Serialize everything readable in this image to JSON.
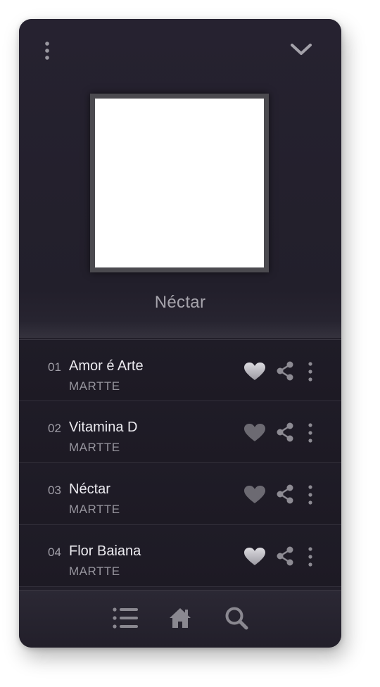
{
  "album": {
    "title": "Néctar"
  },
  "header": {
    "menu_icon": "vertical-dots-icon",
    "collapse_icon": "chevron-down-icon"
  },
  "tracks": [
    {
      "number": "01",
      "title": "Amor é Arte",
      "artist": "MARTTE",
      "liked": true
    },
    {
      "number": "02",
      "title": "Vitamina D",
      "artist": "MARTTE",
      "liked": false
    },
    {
      "number": "03",
      "title": "Néctar",
      "artist": "MARTTE",
      "liked": false
    },
    {
      "number": "04",
      "title": "Flor Baiana",
      "artist": "MARTTE",
      "liked": true
    }
  ],
  "bottom_nav": {
    "items": [
      "list-icon",
      "home-icon",
      "search-icon"
    ]
  },
  "colors": {
    "background": "#221f2a",
    "heart_liked": "#bfbec3",
    "heart_default": "#6f6c74"
  }
}
